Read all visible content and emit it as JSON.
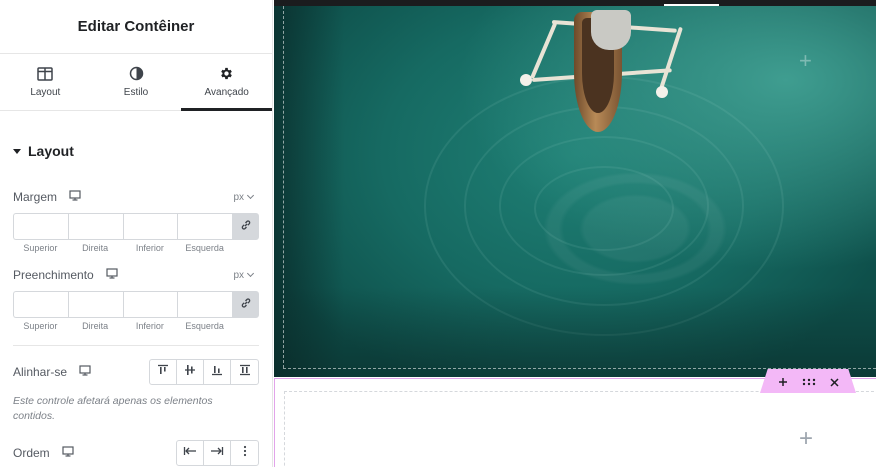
{
  "panel": {
    "title": "Editar Contêiner",
    "tabs": [
      {
        "label": "Layout",
        "icon": "layout-icon"
      },
      {
        "label": "Estilo",
        "icon": "half-circle-icon"
      },
      {
        "label": "Avançado",
        "icon": "gear-icon",
        "active": true
      }
    ],
    "section": {
      "title": "Layout",
      "margin": {
        "label": "Margem",
        "unit": "px",
        "sides": [
          "Superior",
          "Direita",
          "Inferior",
          "Esquerda"
        ],
        "values": [
          "",
          "",
          "",
          ""
        ]
      },
      "padding": {
        "label": "Preenchimento",
        "unit": "px",
        "sides": [
          "Superior",
          "Direita",
          "Inferior",
          "Esquerda"
        ],
        "values": [
          "",
          "",
          "",
          ""
        ]
      },
      "align_self": {
        "label": "Alinhar-se",
        "help": "Este controle afetará apenas os elementos contidos."
      },
      "order": {
        "label": "Ordem"
      }
    }
  },
  "canvas": {
    "handle_icons": [
      "plus-icon",
      "drag-icon",
      "close-icon"
    ]
  },
  "colors": {
    "accent_handle": "#f3b8f7",
    "container_outline": "#e2a4ea",
    "text_dark": "#1f2124"
  }
}
